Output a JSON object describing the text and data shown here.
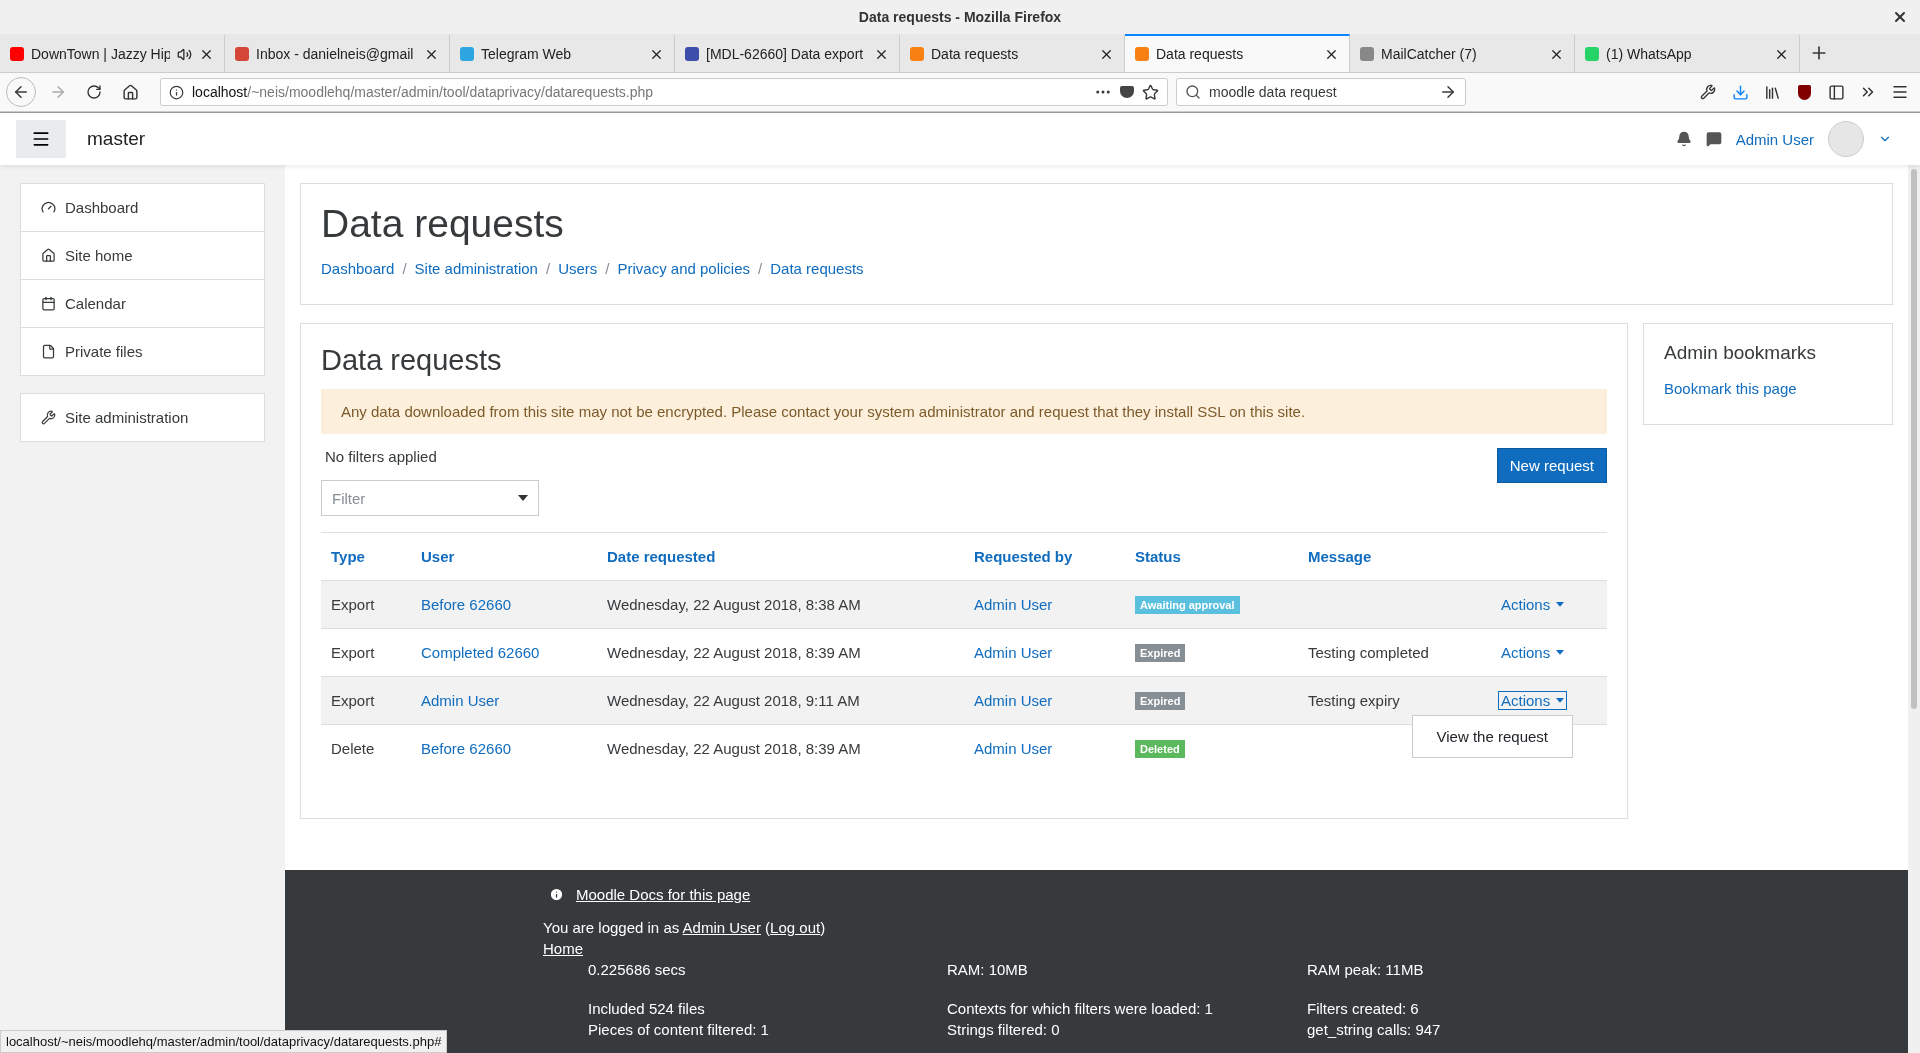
{
  "browser": {
    "window_title": "Data requests - Mozilla Firefox",
    "tabs": [
      {
        "title": "DownTown | Jazzy Hip",
        "selected": false,
        "audio": true
      },
      {
        "title": "Inbox - danielneis@gmail",
        "selected": false,
        "audio": false
      },
      {
        "title": "Telegram Web",
        "selected": false,
        "audio": false
      },
      {
        "title": "[MDL-62660] Data export",
        "selected": false,
        "audio": false
      },
      {
        "title": "Data requests",
        "selected": false,
        "audio": false
      },
      {
        "title": "Data requests",
        "selected": true,
        "audio": false
      },
      {
        "title": "MailCatcher (7)",
        "selected": false,
        "audio": false
      },
      {
        "title": "(1) WhatsApp",
        "selected": false,
        "audio": false
      }
    ],
    "url_host": "localhost",
    "url_path": "/~neis/moodlehq/master/admin/tool/dataprivacy/datarequests.php",
    "search": {
      "value": "moodle data request"
    },
    "status_url": "localhost/~neis/moodlehq/master/admin/tool/dataprivacy/datarequests.php#"
  },
  "header": {
    "site_name": "master",
    "user_name": "Admin User"
  },
  "sidebar": {
    "nav_items": [
      "Dashboard",
      "Site home",
      "Calendar",
      "Private files"
    ],
    "admin_items": [
      "Site administration"
    ]
  },
  "page": {
    "title": "Data requests",
    "breadcrumbs": [
      "Dashboard",
      "Site administration",
      "Users",
      "Privacy and policies",
      "Data requests"
    ],
    "separator": "/"
  },
  "main": {
    "heading": "Data requests",
    "alert": "Any data downloaded from this site may not be encrypted. Please contact your system administrator and request that they install SSL on this site.",
    "filters_text": "No filters applied",
    "filter_placeholder": "Filter",
    "new_button": "New request",
    "table": {
      "columns": [
        "Type",
        "User",
        "Date requested",
        "Requested by",
        "Status",
        "Message"
      ],
      "rows": [
        {
          "type": "Export",
          "user": "Before 62660",
          "date": "Wednesday, 22 August 2018, 8:38 AM",
          "requested_by": "Admin User",
          "status": {
            "label": "Awaiting approval",
            "color": "#5bc0de"
          },
          "message": "",
          "actions": "Actions",
          "open": false
        },
        {
          "type": "Export",
          "user": "Completed 62660",
          "date": "Wednesday, 22 August 2018, 8:39 AM",
          "requested_by": "Admin User",
          "status": {
            "label": "Expired",
            "color": "#868e96"
          },
          "message": "Testing completed",
          "actions": "Actions",
          "open": false
        },
        {
          "type": "Export",
          "user": "Admin User",
          "date": "Wednesday, 22 August 2018, 9:11 AM",
          "requested_by": "Admin User",
          "status": {
            "label": "Expired",
            "color": "#868e96"
          },
          "message": "Testing expiry",
          "actions": "Actions",
          "open": true,
          "menu": [
            "View the request"
          ]
        },
        {
          "type": "Delete",
          "user": "Before 62660",
          "date": "Wednesday, 22 August 2018, 8:39 AM",
          "requested_by": "Admin User",
          "status": {
            "label": "Deleted",
            "color": "#5cb85c"
          },
          "message": ""
        }
      ]
    }
  },
  "bookmarks": {
    "title": "Admin bookmarks",
    "link": "Bookmark this page"
  },
  "footer": {
    "docs_link": "Moodle Docs for this page",
    "login": [
      {
        "text": "You are logged in as ",
        "kind": "text"
      },
      {
        "text": "Admin User",
        "kind": "link"
      },
      {
        "text": " (",
        "kind": "text"
      },
      {
        "text": "Log out",
        "kind": "link"
      },
      {
        "text": ")",
        "kind": "text"
      }
    ],
    "home_link": "Home",
    "perf": [
      [
        "0.225686 secs",
        "RAM: 10MB",
        "RAM peak: 11MB"
      ],
      [
        "Included 524 files",
        "Contexts for which filters were loaded: 1",
        "Filters created: 6"
      ],
      [
        "Pieces of content filtered: 1",
        "Strings filtered: 0",
        "get_string calls: 947"
      ]
    ]
  }
}
